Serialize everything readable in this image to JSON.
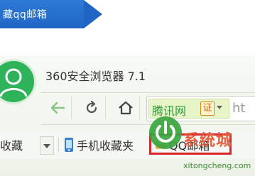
{
  "banner": {
    "text": "藏qq邮箱"
  },
  "browser": {
    "title": "360安全浏览器 7.1",
    "address": {
      "site_name": "腾讯网",
      "cert_label": "证",
      "url_fragment": "ht"
    },
    "bookmarks": {
      "favorites_label": "收藏",
      "mobile_favorites_label": "手机收藏夹",
      "qq_mail_label": "QQ邮箱"
    }
  },
  "watermark": {
    "brand": "系统城",
    "domain": "xitongcheng.com"
  },
  "colors": {
    "banner_blue": "#1f66c4",
    "avatar_green": "#2eb35a",
    "site_green": "#2e9c3a",
    "highlight_red": "#d9262c"
  }
}
